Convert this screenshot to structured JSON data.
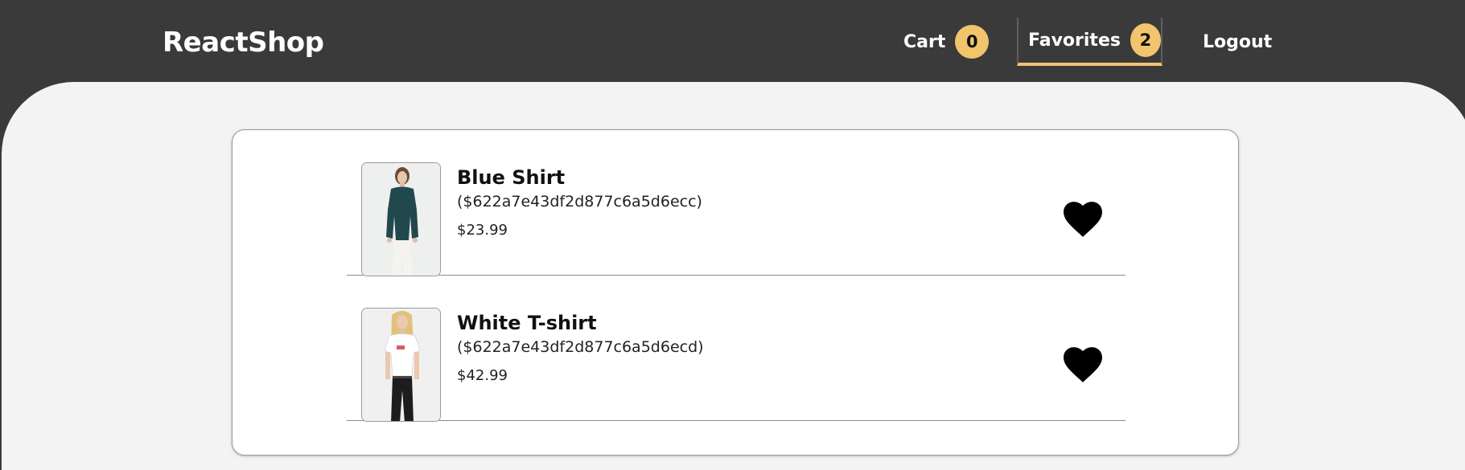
{
  "header": {
    "brand": "ReactShop",
    "nav": {
      "cart_label": "Cart",
      "cart_count": "0",
      "favorites_label": "Favorites",
      "favorites_count": "2",
      "logout_label": "Logout"
    }
  },
  "favorites": [
    {
      "name": "Blue Shirt",
      "id_text": "($622a7e43df2d877c6a5d6ecc)",
      "price": "$23.99",
      "icon": "heart-icon"
    },
    {
      "name": "White T-shirt",
      "id_text": "($622a7e43df2d877c6a5d6ecd)",
      "price": "$42.99",
      "icon": "heart-icon"
    }
  ],
  "colors": {
    "header_bg": "#3a3a3a",
    "accent": "#f2c46c",
    "page_bg": "#f3f3f3"
  }
}
